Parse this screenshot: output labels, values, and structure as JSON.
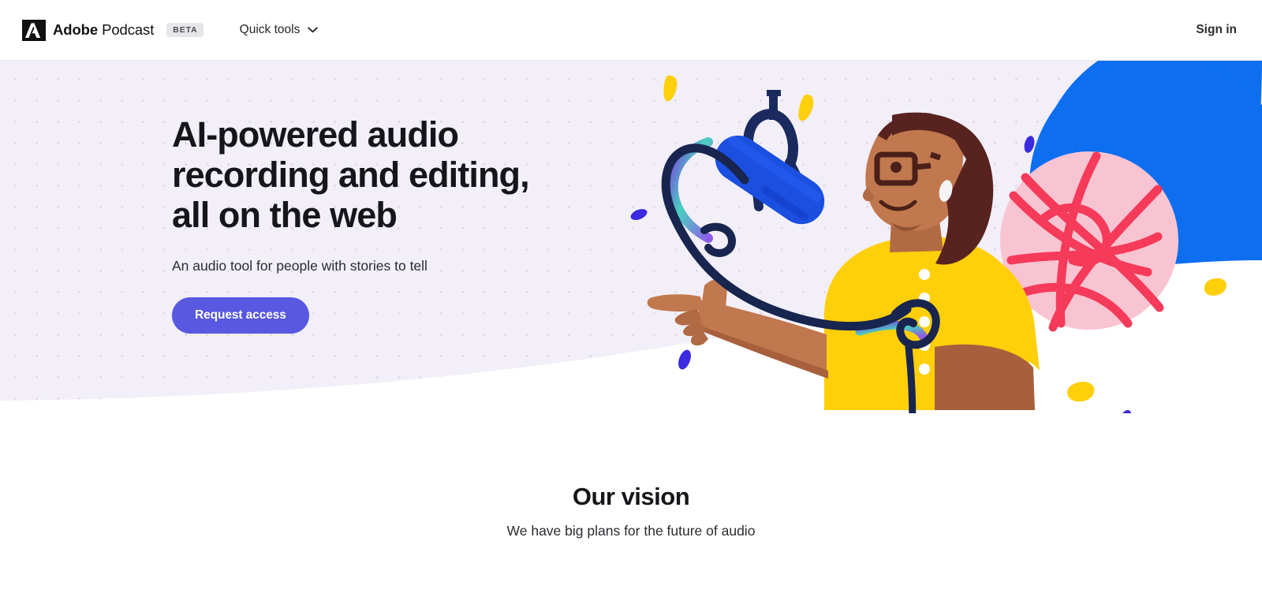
{
  "header": {
    "logo_icon": "adobe-a-logo",
    "brand_bold": "Adobe",
    "brand_regular": " Podcast",
    "beta_label": "BETA",
    "nav": {
      "quick_tools_label": "Quick tools",
      "chevron_icon": "chevron-down-icon"
    },
    "sign_in_label": "Sign in"
  },
  "hero": {
    "title": "AI-powered audio\nrecording and editing,\nall on the web",
    "subtitle": "An audio tool for people with stories to tell",
    "cta_label": "Request access",
    "background_color": "#F2EFF9",
    "accent_color": "#5858E0",
    "illustration": {
      "name": "person-with-microphone-illustration",
      "alt": "Person in yellow shirt with glasses pointing, beside a blue podcast microphone on a boom, with colorful abstract shapes",
      "colors": {
        "mic_body": "#1a4fe0",
        "mic_mount": "#1b2a5e",
        "cable": "#17254f",
        "shirt": "#ffcf0a",
        "skin": "#c2784e",
        "skin_shadow": "#a8603c",
        "hair": "#58231f",
        "blue_blob": "#0d6ef0",
        "pink_blob": "#f9c4d2",
        "pink_scribble": "#f53a5a",
        "confetti_yellow": "#ffcf0a",
        "confetti_purple": "#3b2ae0"
      }
    }
  },
  "vision": {
    "title": "Our vision",
    "subtitle": "We have big plans for the future of audio"
  }
}
